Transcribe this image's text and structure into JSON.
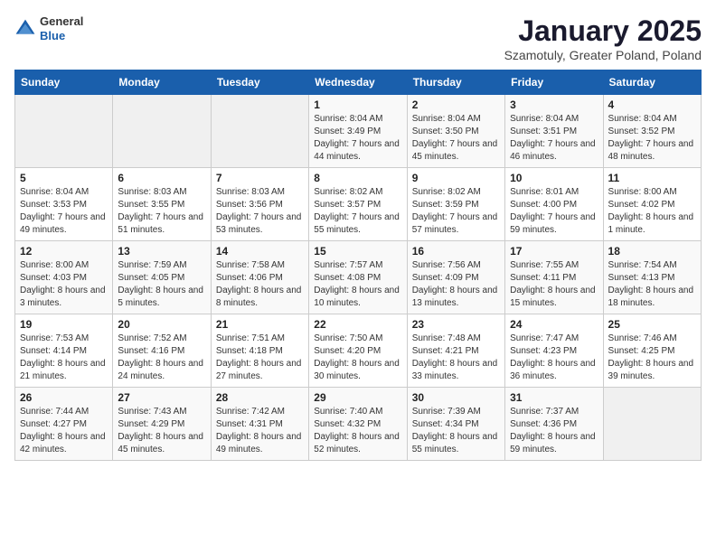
{
  "logo": {
    "general": "General",
    "blue": "Blue"
  },
  "header": {
    "month_title": "January 2025",
    "subtitle": "Szamotuly, Greater Poland, Poland"
  },
  "weekdays": [
    "Sunday",
    "Monday",
    "Tuesday",
    "Wednesday",
    "Thursday",
    "Friday",
    "Saturday"
  ],
  "weeks": [
    [
      {
        "day": "",
        "sunrise": "",
        "sunset": "",
        "daylight": ""
      },
      {
        "day": "",
        "sunrise": "",
        "sunset": "",
        "daylight": ""
      },
      {
        "day": "",
        "sunrise": "",
        "sunset": "",
        "daylight": ""
      },
      {
        "day": "1",
        "sunrise": "Sunrise: 8:04 AM",
        "sunset": "Sunset: 3:49 PM",
        "daylight": "Daylight: 7 hours and 44 minutes."
      },
      {
        "day": "2",
        "sunrise": "Sunrise: 8:04 AM",
        "sunset": "Sunset: 3:50 PM",
        "daylight": "Daylight: 7 hours and 45 minutes."
      },
      {
        "day": "3",
        "sunrise": "Sunrise: 8:04 AM",
        "sunset": "Sunset: 3:51 PM",
        "daylight": "Daylight: 7 hours and 46 minutes."
      },
      {
        "day": "4",
        "sunrise": "Sunrise: 8:04 AM",
        "sunset": "Sunset: 3:52 PM",
        "daylight": "Daylight: 7 hours and 48 minutes."
      }
    ],
    [
      {
        "day": "5",
        "sunrise": "Sunrise: 8:04 AM",
        "sunset": "Sunset: 3:53 PM",
        "daylight": "Daylight: 7 hours and 49 minutes."
      },
      {
        "day": "6",
        "sunrise": "Sunrise: 8:03 AM",
        "sunset": "Sunset: 3:55 PM",
        "daylight": "Daylight: 7 hours and 51 minutes."
      },
      {
        "day": "7",
        "sunrise": "Sunrise: 8:03 AM",
        "sunset": "Sunset: 3:56 PM",
        "daylight": "Daylight: 7 hours and 53 minutes."
      },
      {
        "day": "8",
        "sunrise": "Sunrise: 8:02 AM",
        "sunset": "Sunset: 3:57 PM",
        "daylight": "Daylight: 7 hours and 55 minutes."
      },
      {
        "day": "9",
        "sunrise": "Sunrise: 8:02 AM",
        "sunset": "Sunset: 3:59 PM",
        "daylight": "Daylight: 7 hours and 57 minutes."
      },
      {
        "day": "10",
        "sunrise": "Sunrise: 8:01 AM",
        "sunset": "Sunset: 4:00 PM",
        "daylight": "Daylight: 7 hours and 59 minutes."
      },
      {
        "day": "11",
        "sunrise": "Sunrise: 8:00 AM",
        "sunset": "Sunset: 4:02 PM",
        "daylight": "Daylight: 8 hours and 1 minute."
      }
    ],
    [
      {
        "day": "12",
        "sunrise": "Sunrise: 8:00 AM",
        "sunset": "Sunset: 4:03 PM",
        "daylight": "Daylight: 8 hours and 3 minutes."
      },
      {
        "day": "13",
        "sunrise": "Sunrise: 7:59 AM",
        "sunset": "Sunset: 4:05 PM",
        "daylight": "Daylight: 8 hours and 5 minutes."
      },
      {
        "day": "14",
        "sunrise": "Sunrise: 7:58 AM",
        "sunset": "Sunset: 4:06 PM",
        "daylight": "Daylight: 8 hours and 8 minutes."
      },
      {
        "day": "15",
        "sunrise": "Sunrise: 7:57 AM",
        "sunset": "Sunset: 4:08 PM",
        "daylight": "Daylight: 8 hours and 10 minutes."
      },
      {
        "day": "16",
        "sunrise": "Sunrise: 7:56 AM",
        "sunset": "Sunset: 4:09 PM",
        "daylight": "Daylight: 8 hours and 13 minutes."
      },
      {
        "day": "17",
        "sunrise": "Sunrise: 7:55 AM",
        "sunset": "Sunset: 4:11 PM",
        "daylight": "Daylight: 8 hours and 15 minutes."
      },
      {
        "day": "18",
        "sunrise": "Sunrise: 7:54 AM",
        "sunset": "Sunset: 4:13 PM",
        "daylight": "Daylight: 8 hours and 18 minutes."
      }
    ],
    [
      {
        "day": "19",
        "sunrise": "Sunrise: 7:53 AM",
        "sunset": "Sunset: 4:14 PM",
        "daylight": "Daylight: 8 hours and 21 minutes."
      },
      {
        "day": "20",
        "sunrise": "Sunrise: 7:52 AM",
        "sunset": "Sunset: 4:16 PM",
        "daylight": "Daylight: 8 hours and 24 minutes."
      },
      {
        "day": "21",
        "sunrise": "Sunrise: 7:51 AM",
        "sunset": "Sunset: 4:18 PM",
        "daylight": "Daylight: 8 hours and 27 minutes."
      },
      {
        "day": "22",
        "sunrise": "Sunrise: 7:50 AM",
        "sunset": "Sunset: 4:20 PM",
        "daylight": "Daylight: 8 hours and 30 minutes."
      },
      {
        "day": "23",
        "sunrise": "Sunrise: 7:48 AM",
        "sunset": "Sunset: 4:21 PM",
        "daylight": "Daylight: 8 hours and 33 minutes."
      },
      {
        "day": "24",
        "sunrise": "Sunrise: 7:47 AM",
        "sunset": "Sunset: 4:23 PM",
        "daylight": "Daylight: 8 hours and 36 minutes."
      },
      {
        "day": "25",
        "sunrise": "Sunrise: 7:46 AM",
        "sunset": "Sunset: 4:25 PM",
        "daylight": "Daylight: 8 hours and 39 minutes."
      }
    ],
    [
      {
        "day": "26",
        "sunrise": "Sunrise: 7:44 AM",
        "sunset": "Sunset: 4:27 PM",
        "daylight": "Daylight: 8 hours and 42 minutes."
      },
      {
        "day": "27",
        "sunrise": "Sunrise: 7:43 AM",
        "sunset": "Sunset: 4:29 PM",
        "daylight": "Daylight: 8 hours and 45 minutes."
      },
      {
        "day": "28",
        "sunrise": "Sunrise: 7:42 AM",
        "sunset": "Sunset: 4:31 PM",
        "daylight": "Daylight: 8 hours and 49 minutes."
      },
      {
        "day": "29",
        "sunrise": "Sunrise: 7:40 AM",
        "sunset": "Sunset: 4:32 PM",
        "daylight": "Daylight: 8 hours and 52 minutes."
      },
      {
        "day": "30",
        "sunrise": "Sunrise: 7:39 AM",
        "sunset": "Sunset: 4:34 PM",
        "daylight": "Daylight: 8 hours and 55 minutes."
      },
      {
        "day": "31",
        "sunrise": "Sunrise: 7:37 AM",
        "sunset": "Sunset: 4:36 PM",
        "daylight": "Daylight: 8 hours and 59 minutes."
      },
      {
        "day": "",
        "sunrise": "",
        "sunset": "",
        "daylight": ""
      }
    ]
  ]
}
